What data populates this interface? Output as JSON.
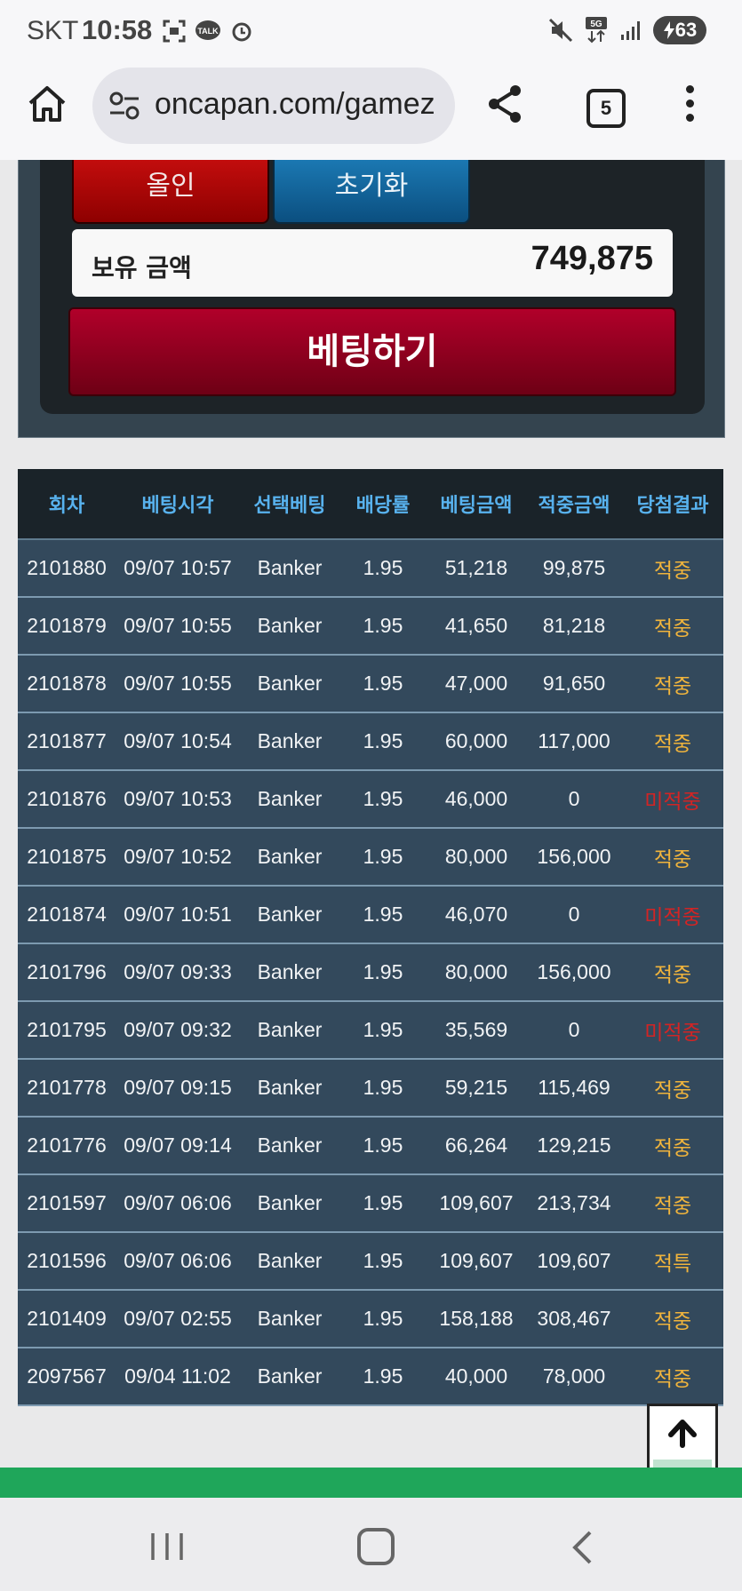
{
  "status_bar": {
    "carrier": "SKT",
    "time": "10:58",
    "battery": "63"
  },
  "browser": {
    "url": "oncapan.com/gamez",
    "tab_count": "5"
  },
  "panel": {
    "allin_label": "올인",
    "reset_label": "초기화",
    "balance_label": "보유 금액",
    "balance_value": "749,875",
    "bet_button_label": "베팅하기"
  },
  "table": {
    "headers": [
      "회차",
      "베팅시각",
      "선택베팅",
      "배당률",
      "베팅금액",
      "적중금액",
      "당첨결과"
    ],
    "rows": [
      {
        "round": "2101880",
        "time": "09/07 10:57",
        "pick": "Banker",
        "odds": "1.95",
        "bet": "51,218",
        "win": "99,875",
        "result": "적중",
        "status": "hit"
      },
      {
        "round": "2101879",
        "time": "09/07 10:55",
        "pick": "Banker",
        "odds": "1.95",
        "bet": "41,650",
        "win": "81,218",
        "result": "적중",
        "status": "hit"
      },
      {
        "round": "2101878",
        "time": "09/07 10:55",
        "pick": "Banker",
        "odds": "1.95",
        "bet": "47,000",
        "win": "91,650",
        "result": "적중",
        "status": "hit"
      },
      {
        "round": "2101877",
        "time": "09/07 10:54",
        "pick": "Banker",
        "odds": "1.95",
        "bet": "60,000",
        "win": "117,000",
        "result": "적중",
        "status": "hit"
      },
      {
        "round": "2101876",
        "time": "09/07 10:53",
        "pick": "Banker",
        "odds": "1.95",
        "bet": "46,000",
        "win": "0",
        "result": "미적중",
        "status": "miss"
      },
      {
        "round": "2101875",
        "time": "09/07 10:52",
        "pick": "Banker",
        "odds": "1.95",
        "bet": "80,000",
        "win": "156,000",
        "result": "적중",
        "status": "hit"
      },
      {
        "round": "2101874",
        "time": "09/07 10:51",
        "pick": "Banker",
        "odds": "1.95",
        "bet": "46,070",
        "win": "0",
        "result": "미적중",
        "status": "miss"
      },
      {
        "round": "2101796",
        "time": "09/07 09:33",
        "pick": "Banker",
        "odds": "1.95",
        "bet": "80,000",
        "win": "156,000",
        "result": "적중",
        "status": "hit"
      },
      {
        "round": "2101795",
        "time": "09/07 09:32",
        "pick": "Banker",
        "odds": "1.95",
        "bet": "35,569",
        "win": "0",
        "result": "미적중",
        "status": "miss"
      },
      {
        "round": "2101778",
        "time": "09/07 09:15",
        "pick": "Banker",
        "odds": "1.95",
        "bet": "59,215",
        "win": "115,469",
        "result": "적중",
        "status": "hit"
      },
      {
        "round": "2101776",
        "time": "09/07 09:14",
        "pick": "Banker",
        "odds": "1.95",
        "bet": "66,264",
        "win": "129,215",
        "result": "적중",
        "status": "hit"
      },
      {
        "round": "2101597",
        "time": "09/07 06:06",
        "pick": "Banker",
        "odds": "1.95",
        "bet": "109,607",
        "win": "213,734",
        "result": "적중",
        "status": "hit"
      },
      {
        "round": "2101596",
        "time": "09/07 06:06",
        "pick": "Banker",
        "odds": "1.95",
        "bet": "109,607",
        "win": "109,607",
        "result": "적특",
        "status": "special"
      },
      {
        "round": "2101409",
        "time": "09/07 02:55",
        "pick": "Banker",
        "odds": "1.95",
        "bet": "158,188",
        "win": "308,467",
        "result": "적중",
        "status": "hit"
      },
      {
        "round": "2097567",
        "time": "09/04 11:02",
        "pick": "Banker",
        "odds": "1.95",
        "bet": "40,000",
        "win": "78,000",
        "result": "적중",
        "status": "hit"
      }
    ]
  },
  "colors": {
    "header_text": "#58b2ee",
    "hit": "#f0b43c",
    "miss": "#d32424",
    "row_bg": "#33495c"
  }
}
